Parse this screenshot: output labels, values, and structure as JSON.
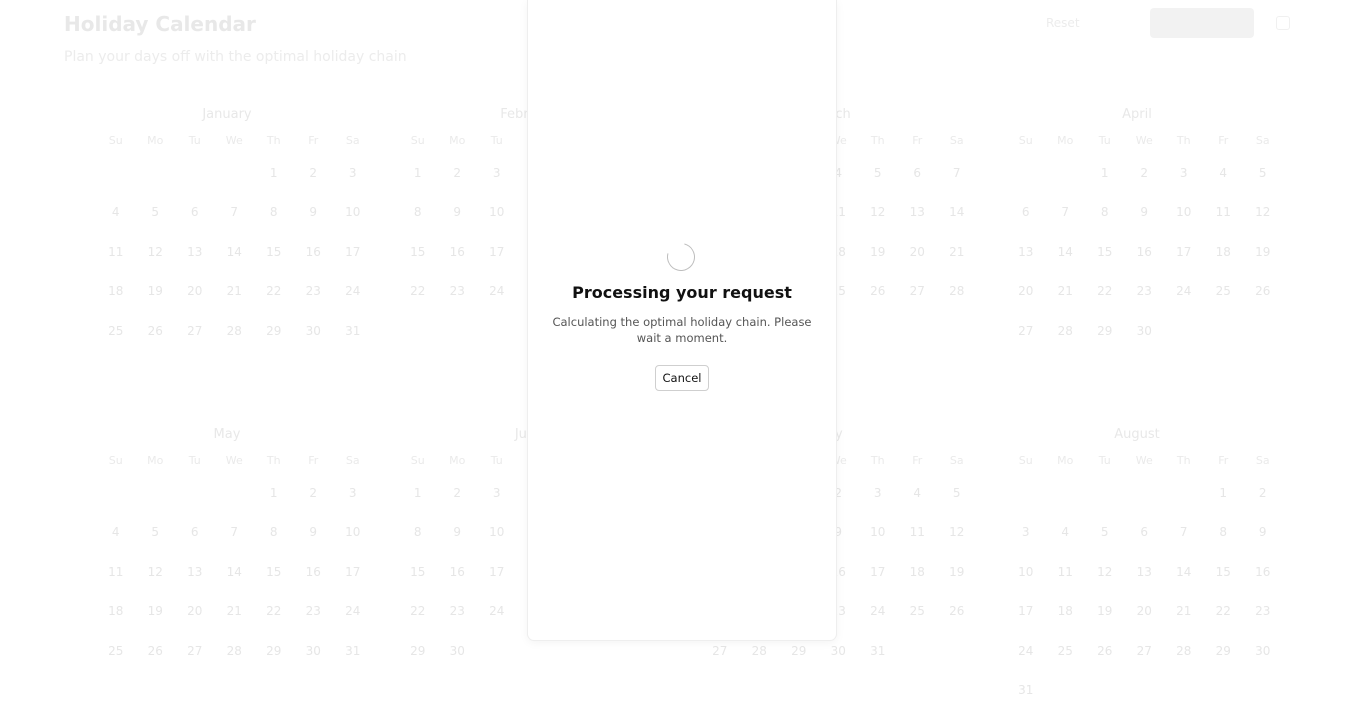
{
  "page": {
    "title": "Holiday Calendar",
    "subtitle": "Plan your days off with the optimal holiday chain",
    "header_link": "Reset",
    "primary_button": "Calculate"
  },
  "weekdays": [
    "Su",
    "Mo",
    "Tu",
    "We",
    "Th",
    "Fr",
    "Sa"
  ],
  "months_top": [
    {
      "name": "January",
      "start": 4,
      "days": 31
    },
    {
      "name": "February",
      "start": 0,
      "days": 28
    },
    {
      "name": "March",
      "start": 0,
      "days": 31
    },
    {
      "name": "April",
      "start": 2,
      "days": 30
    }
  ],
  "months_bottom": [
    {
      "name": "May",
      "start": 4,
      "days": 31
    },
    {
      "name": "June",
      "start": 0,
      "days": 30
    },
    {
      "name": "July",
      "start": 2,
      "days": 31
    },
    {
      "name": "August",
      "start": 5,
      "days": 31
    }
  ],
  "modal": {
    "title": "Processing your request",
    "message": "Calculating the optimal holiday chain. Please wait a moment.",
    "cancel_label": "Cancel"
  },
  "colors": {
    "modal_bg": "#ffffff",
    "spinner": "#bdbdbd",
    "highlight_green": "#e8f8ef"
  }
}
